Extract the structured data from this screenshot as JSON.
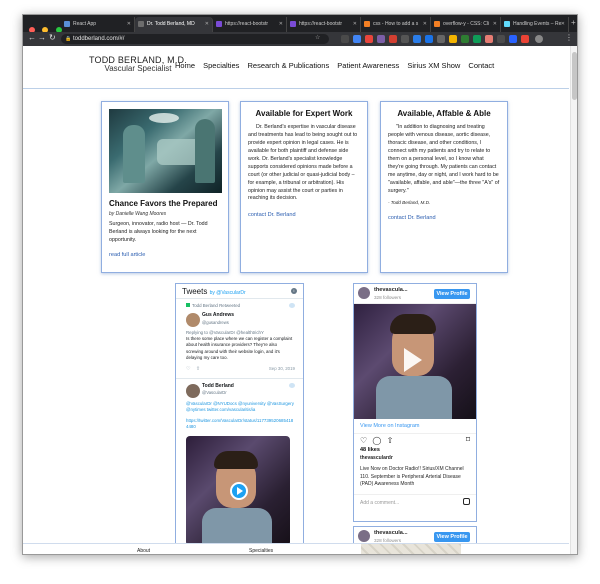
{
  "browser": {
    "tabs": [
      {
        "label": "React App",
        "active": false
      },
      {
        "label": "Dr. Todd Berland, MD",
        "active": true
      },
      {
        "label": "https://react-bootstr",
        "active": false
      },
      {
        "label": "https://react-bootstr",
        "active": false
      },
      {
        "label": "css - How to add a s",
        "active": false
      },
      {
        "label": "overflow-y - CSS: Cli",
        "active": false
      },
      {
        "label": "Handling Events – Re",
        "active": false
      }
    ],
    "url": "toddberland.com/#/",
    "colors": {
      "frame": "#202124",
      "toolbar": "#35363a",
      "accent": "#2a5db0"
    }
  },
  "site": {
    "brand_name": "TODD BERLAND, M.D.",
    "brand_sub": "Vascular Specialist",
    "nav": [
      "Home",
      "Specialties",
      "Research & Publications",
      "Patient Awareness",
      "Sirius XM Show",
      "Contact"
    ]
  },
  "cards": {
    "c1": {
      "title": "Chance Favors the Prepared",
      "byline": "by Danielle Wang Moores",
      "body": "Surgeon, innovator, radio host — Dr. Todd Berland is always looking for the next opportunity.",
      "link": "read full article"
    },
    "c2": {
      "title": "Available for Expert Work",
      "body": "Dr. Berland's expertise in vascular disease and treatments has lead to being sought out to provide expert opinion in legal cases. He is available for both plaintiff and defense side work. Dr. Berland's specialist knowledge supports considered opinions made before a court (or other judicial or quasi-judicial body – for example, a tribunal or arbitration). His opinion may assist the court or parties in reaching its decision.",
      "link": "contact Dr. Berland"
    },
    "c3": {
      "title": "Available, Affable & Able",
      "body": "\"In addition to diagnosing and treating people with venous disease, aortic disease, thoracic disease, and other conditions, I connect with my patients and try to relate to them on a personal level, so I know what they're going through. My patients can contact me anytime, day or night, and I work hard to be \"available, affable, and able\"—the three \"A's\" of surgery.\"",
      "attribution": "- Todd Berland, M.D.",
      "link": "contact Dr. Berland"
    }
  },
  "tweets": {
    "header": "Tweets",
    "by": "by @VascularDr",
    "items": [
      {
        "retweet": "Todd Berland Retweeted",
        "name": "Gus Andrews",
        "handle": "@gusandrews",
        "reply": "Replying to @VascularDr @healthtrichY",
        "text": "Is there some place where we can register a complaint about health insurance providers? They're also screwing around with their website login, and it's delaying my care too.",
        "date": "Sep 30, 2019"
      },
      {
        "name": "Todd Berland",
        "handle": "@VascularDr",
        "text": "@VascularDr @NYUDocs @nyuniversity @VasSurgery @nytimes twitter.com/vascularitis/ia",
        "link": "https://twitter.com/VascularDr/status/1177395206854184480"
      }
    ]
  },
  "instagram": [
    {
      "user": "thevascula...",
      "followers": "328 followers",
      "button": "View Profile",
      "more": "View More on Instagram",
      "likes": "48 likes",
      "caption_user": "thevasculardr",
      "caption": "Live Now on Doctor Radio!! Sirius/XM Channel 110. September is Peripheral Arterial Disease (PAD) Awareness Month",
      "comment_placeholder": "Add a comment..."
    },
    {
      "user": "thevascula...",
      "followers": "328 followers",
      "button": "View Profile"
    }
  ],
  "footer": {
    "about": "About",
    "specialties": "Specialties"
  }
}
